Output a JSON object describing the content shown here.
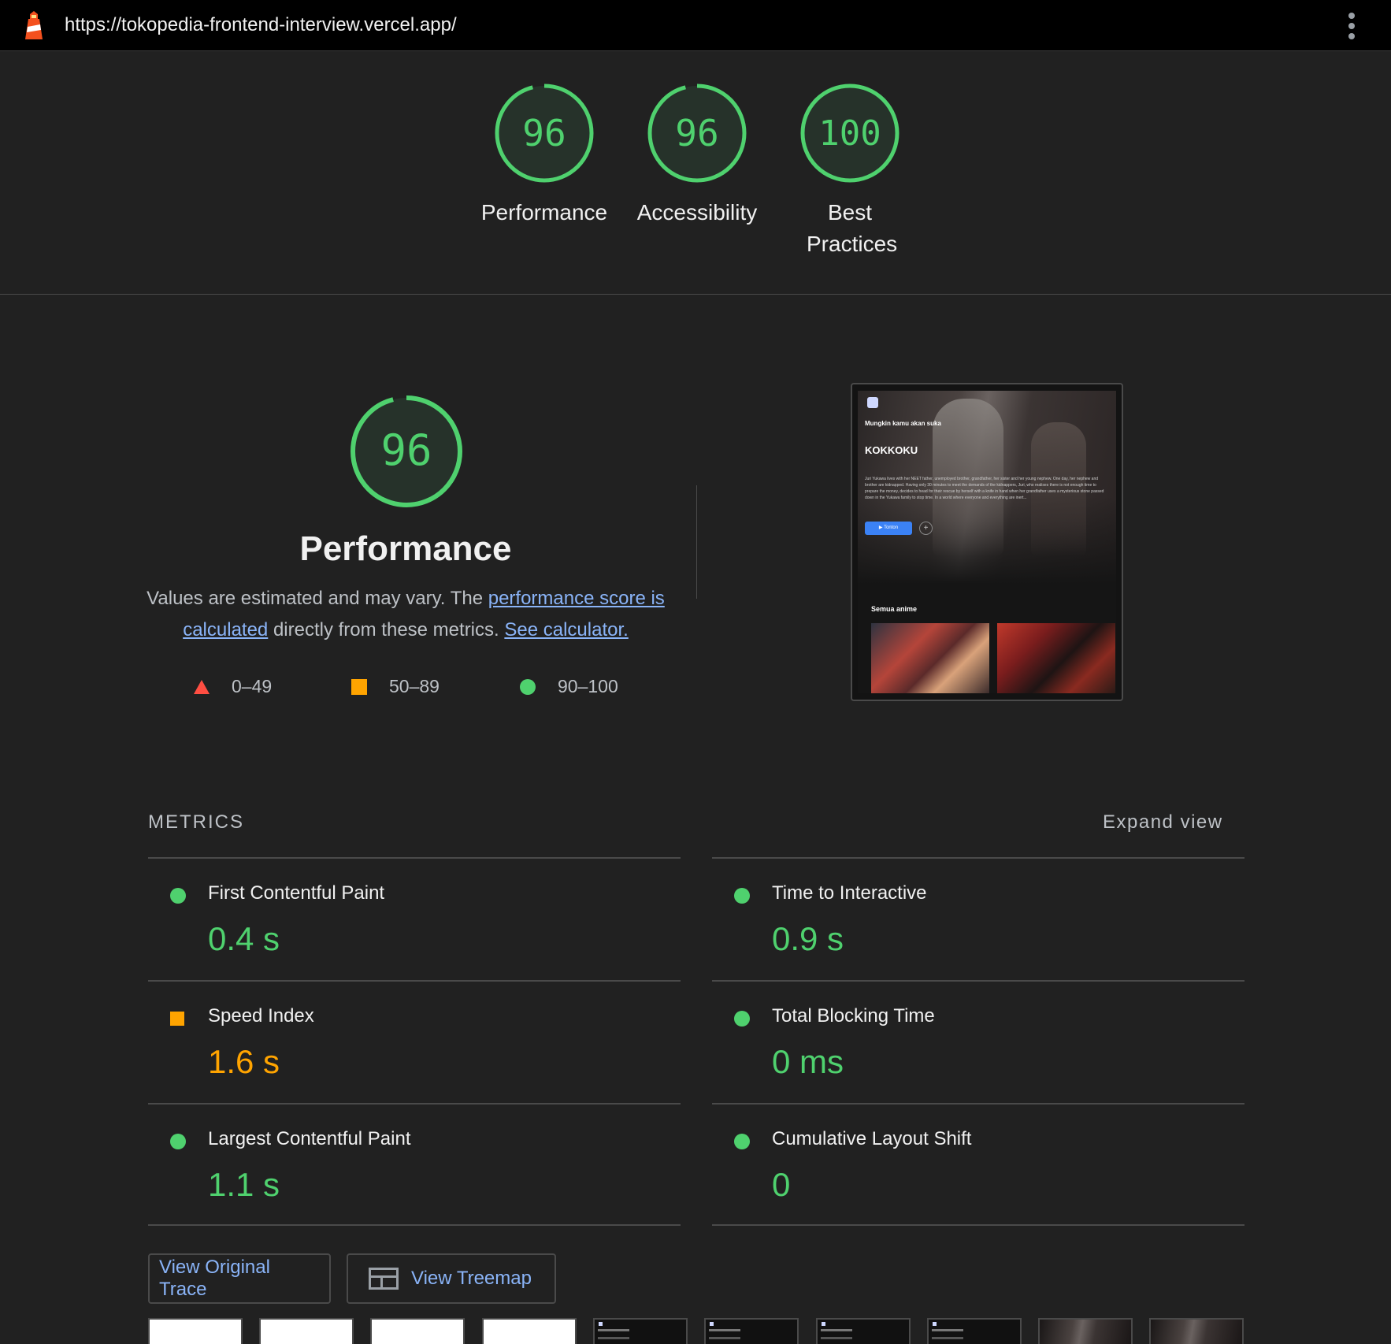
{
  "topbar": {
    "url": "https://tokopedia-frontend-interview.vercel.app/"
  },
  "gauges": [
    {
      "label": "Performance",
      "score": 96
    },
    {
      "label": "Accessibility",
      "score": 96
    },
    {
      "label": "Best Practices",
      "score": 100
    }
  ],
  "performance": {
    "score": 96,
    "title": "Performance",
    "desc_start": "Values are estimated and may vary. The ",
    "desc_link1": "performance score is calculated",
    "desc_mid": " directly from these metrics. ",
    "desc_link2": "See calculator.",
    "legend": {
      "fail": "0–49",
      "average": "50–89",
      "pass": "90–100"
    }
  },
  "screenshot": {
    "subtitle": "Mungkin kamu akan suka",
    "title": "KOKKOKU",
    "description": "Juri Yukawa lives with her NEET father, unemployed brother, grandfather, her sister and her young nephew. One day, her nephew and brother are kidnapped. Having only 30 minutes to meet the demands of the kidnappers, Juri, who realises there is not enough time to prepare the money, decides to head for their rescue by herself with a knife in hand when her grandfather uses a mysterious stone passed down in the Yukawa family to stop time. In a world where everyone and everything are inert...",
    "watch_button": "▶ Tonton",
    "section": "Semua anime"
  },
  "metrics": {
    "heading": "METRICS",
    "expand": "Expand view",
    "items": [
      {
        "label": "First Contentful Paint",
        "value": "0.4 s",
        "status": "pass"
      },
      {
        "label": "Time to Interactive",
        "value": "0.9 s",
        "status": "pass"
      },
      {
        "label": "Speed Index",
        "value": "1.6 s",
        "status": "average"
      },
      {
        "label": "Total Blocking Time",
        "value": "0 ms",
        "status": "pass"
      },
      {
        "label": "Largest Contentful Paint",
        "value": "1.1 s",
        "status": "pass"
      },
      {
        "label": "Cumulative Layout Shift",
        "value": "0",
        "status": "pass"
      }
    ]
  },
  "buttons": {
    "trace": "View Original Trace",
    "treemap": "View Treemap"
  },
  "colors": {
    "pass": "#4fd16e",
    "average": "#ffa400",
    "fail": "#ff4e42",
    "link": "#8ab4f8",
    "background": "#212121"
  }
}
